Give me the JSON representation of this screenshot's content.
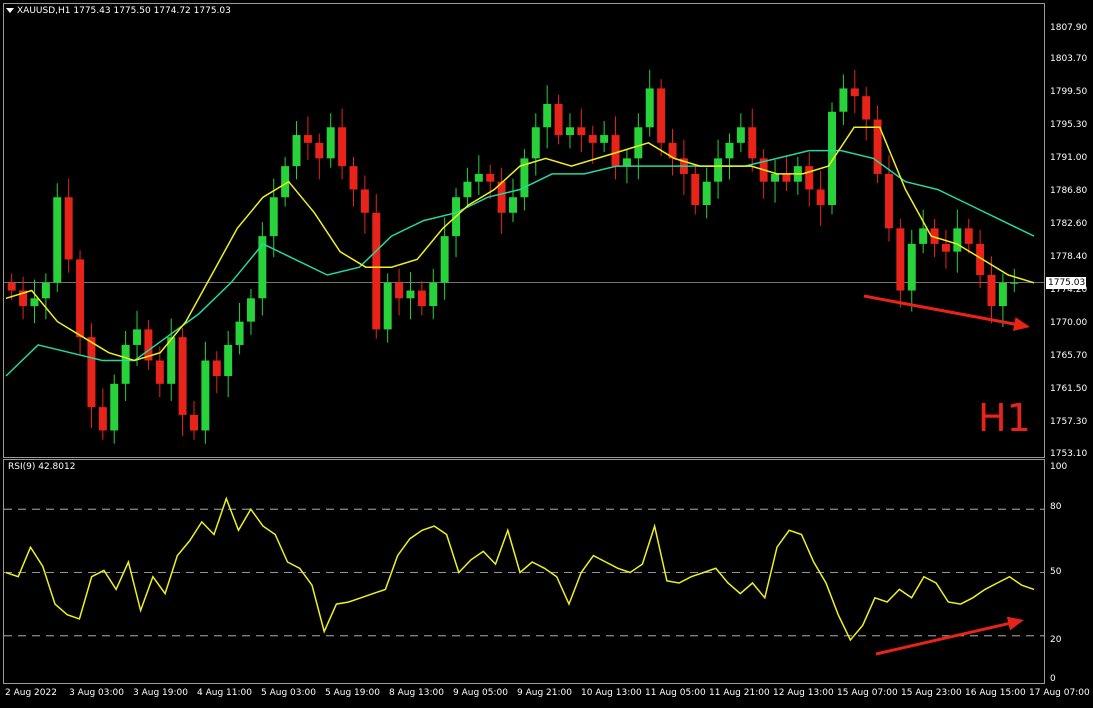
{
  "symbol_header": {
    "symbol": "XAUUSD,H1",
    "open": "1775.43",
    "high": "1775.50",
    "low": "1774.72",
    "close": "1775.03"
  },
  "rsi_header": "RSI(9) 42.8012",
  "timeframe_label": "H1",
  "current_price": "1775.03",
  "price_axis": [
    "1807.90",
    "1803.70",
    "1799.50",
    "1795.30",
    "1791.00",
    "1786.80",
    "1782.60",
    "1778.40",
    "1774.20",
    "1770.00",
    "1765.70",
    "1761.50",
    "1757.30",
    "1753.10"
  ],
  "rsi_axis": [
    "100",
    "80",
    "50",
    "20",
    "0"
  ],
  "time_axis": [
    "2 Aug 2022",
    "3 Aug 03:00",
    "3 Aug 19:00",
    "4 Aug 11:00",
    "5 Aug 03:00",
    "5 Aug 19:00",
    "8 Aug 13:00",
    "9 Aug 05:00",
    "9 Aug 21:00",
    "10 Aug 13:00",
    "11 Aug 05:00",
    "11 Aug 21:00",
    "12 Aug 13:00",
    "15 Aug 07:00",
    "15 Aug 23:00",
    "16 Aug 15:00",
    "17 Aug 07:00"
  ],
  "colors": {
    "bull": "#27d23a",
    "bear": "#e8231a",
    "ma_fast": "#f0f020",
    "ma_slow": "#24d8a0",
    "rsi": "#f0f020",
    "arrow": "#e8231a"
  },
  "chart_data": [
    {
      "type": "candlestick",
      "title": "XAUUSD,H1",
      "ylim": [
        1753.1,
        1807.9
      ],
      "series": [
        {
          "values": [
            1774,
            1772,
            1773,
            1775,
            1786,
            1778,
            1768,
            1759,
            1756,
            1762,
            1767,
            1769,
            1765,
            1762,
            1768,
            1758,
            1756,
            1765,
            1763,
            1767,
            1770,
            1773,
            1781,
            1786,
            1790,
            1794,
            1793,
            1791,
            1795,
            1790,
            1787,
            1784,
            1769,
            1775,
            1773,
            1774,
            1772,
            1775,
            1781,
            1786,
            1788,
            1789,
            1788,
            1784,
            1786,
            1791,
            1795,
            1798,
            1794,
            1795,
            1794,
            1793,
            1794,
            1790,
            1791,
            1795,
            1800,
            1793,
            1791,
            1789,
            1785,
            1788,
            1791,
            1793,
            1795,
            1791,
            1788,
            1789,
            1788,
            1790,
            1787,
            1785,
            1797,
            1800,
            1799,
            1796,
            1789,
            1782,
            1774,
            1780,
            1782,
            1780,
            1779,
            1782,
            1780,
            1776,
            1772,
            1775,
            1775
          ]
        },
        {
          "name": "MA fast",
          "values": [
            1773,
            1774,
            1770,
            1768,
            1766,
            1765,
            1766,
            1770,
            1776,
            1782,
            1786,
            1788,
            1784,
            1779,
            1777,
            1777,
            1778,
            1782,
            1785,
            1787,
            1790,
            1791,
            1790,
            1791,
            1792,
            1793,
            1791,
            1790,
            1790,
            1790,
            1789,
            1789,
            1790,
            1795,
            1795,
            1787,
            1781,
            1780,
            1778,
            1776,
            1775
          ]
        },
        {
          "name": "MA slow",
          "values": [
            1763,
            1767,
            1766,
            1765,
            1765,
            1768,
            1771,
            1775,
            1780,
            1778,
            1776,
            1777,
            1781,
            1783,
            1784,
            1786,
            1787,
            1789,
            1789,
            1790,
            1790,
            1790,
            1790,
            1790,
            1791,
            1792,
            1792,
            1791,
            1788,
            1787,
            1785,
            1783,
            1781
          ]
        }
      ]
    },
    {
      "type": "line",
      "title": "RSI(9) 42.8012",
      "ylim": [
        0,
        100
      ],
      "series": [
        {
          "name": "RSI(9)",
          "values": [
            50,
            48,
            62,
            53,
            35,
            30,
            28,
            48,
            51,
            42,
            55,
            32,
            48,
            40,
            58,
            65,
            74,
            68,
            85,
            70,
            80,
            72,
            68,
            55,
            52,
            44,
            22,
            35,
            36,
            38,
            40,
            42,
            58,
            66,
            70,
            72,
            68,
            50,
            56,
            60,
            54,
            70,
            50,
            55,
            52,
            48,
            35,
            50,
            58,
            55,
            52,
            50,
            54,
            72,
            46,
            45,
            48,
            50,
            52,
            45,
            40,
            45,
            38,
            62,
            70,
            68,
            55,
            45,
            30,
            18,
            25,
            38,
            36,
            42,
            38,
            48,
            45,
            36,
            35,
            38,
            42,
            45,
            48,
            44,
            42
          ]
        }
      ],
      "guides": [
        80,
        50,
        20
      ]
    }
  ]
}
